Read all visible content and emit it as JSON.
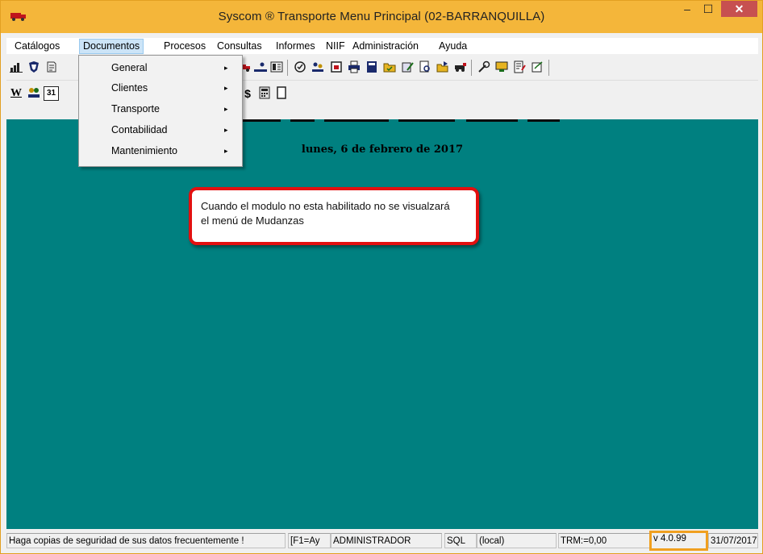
{
  "window": {
    "title": "Syscom ® Transporte Menu Principal (02-BARRANQUILLA)",
    "controls": {
      "minimize": "–",
      "maximize": "☐",
      "close": "✕"
    },
    "accent_color": "#f4b63a"
  },
  "menubar": {
    "items": [
      "Catálogos",
      "Documentos",
      "Procesos",
      "Consultas",
      "Informes",
      "NIIF",
      "Administración",
      "Ayuda"
    ],
    "active": "Documentos"
  },
  "dropdown": {
    "items": [
      {
        "label": "General"
      },
      {
        "label": "Clientes"
      },
      {
        "label": "Transporte"
      },
      {
        "label": "Contabilidad"
      },
      {
        "label": "Mantenimiento"
      }
    ],
    "submenu_arrow": "▸"
  },
  "toolbar1": {
    "icons": [
      "chart-icon",
      "shield-icon",
      "document-icon",
      "truck-icon",
      "person-desk-icon",
      "book-icon",
      "checklist-icon",
      "people-icon",
      "calendar-doc-icon",
      "printer-icon",
      "ledger-icon",
      "folder-check-icon",
      "edit-doc-icon",
      "search-doc-icon",
      "folder-arrow-icon",
      "vehicle-icon",
      "tools-icon",
      "settings-card-icon",
      "notes-icon",
      "report-icon"
    ]
  },
  "toolbar2": {
    "icons": [
      "word-icon",
      "users-icon",
      "calendar-31-icon",
      "refresh-icon",
      "dollar-icon",
      "calculator-icon",
      "page-icon"
    ],
    "word_glyph": "W",
    "calendar_glyph": "31",
    "dollar_glyph": "$"
  },
  "main": {
    "background": "#008080",
    "date": "lunes, 6 de febrero de 2017",
    "callout": "Cuando el modulo no esta habilitado no se visualzará el menú de Mudanzas",
    "callout_border": "#e31010"
  },
  "statusbar": {
    "backup_msg": "Haga copias de seguridad de sus datos frecuentemente !",
    "help": "[F1=Ay",
    "user": "ADMINISTRADOR",
    "db_type": "SQL",
    "server": "(local)",
    "trm": "TRM:=0,00",
    "version": "v 4.0.99",
    "date": "31/07/2017"
  }
}
